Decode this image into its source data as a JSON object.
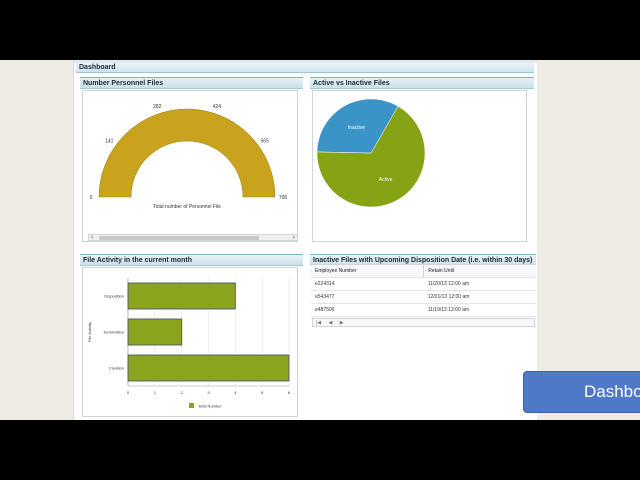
{
  "dashboard": {
    "title": "Dashboard"
  },
  "gauge_panel": {
    "title": "Number Personnel Files",
    "caption": "Total number of Personnel File",
    "chart_data": {
      "type": "gauge",
      "min": 0,
      "max": 706,
      "value": 600,
      "ticks": [
        0,
        141,
        282,
        424,
        565,
        706
      ],
      "color": "#c9a21e",
      "xlabel": "Total number of Personnel File"
    }
  },
  "pie_panel": {
    "title": "Active vs Inactive Files",
    "chart_data": {
      "type": "pie",
      "slices": [
        {
          "label": "Active",
          "value": 67,
          "color": "#86a315"
        },
        {
          "label": "Inactive",
          "value": 33,
          "color": "#3a95c6"
        }
      ]
    }
  },
  "bar_panel": {
    "title": "File Activity in the current month",
    "chart_data": {
      "type": "bar",
      "orientation": "horizontal",
      "categories": [
        "Disposition",
        "Termination",
        "Creation"
      ],
      "series": [
        {
          "name": "Total Number",
          "values": [
            4,
            2,
            6
          ],
          "color": "#8aa51d"
        }
      ],
      "ylabel": "File Activity",
      "xlim": [
        0,
        6
      ],
      "x_ticks": [
        "0",
        "1",
        "2",
        "3",
        "4",
        "5",
        "6"
      ],
      "grid": true,
      "legend": "bottom"
    }
  },
  "table_panel": {
    "title": "Inactive Files with Upcoming Disposition Date (i.e. within 30 days)",
    "columns": [
      "Employee Number",
      "Retain Until"
    ],
    "rows": [
      [
        "e224314",
        "11/20/13 12:00 am"
      ],
      [
        "e543477",
        "12/01/13 12:00 am"
      ],
      [
        "e487500",
        "11/19/13 12:00 am"
      ]
    ],
    "pager": [
      "|◀",
      "◀",
      "▶"
    ]
  },
  "side_button": {
    "label": "Dashboard"
  }
}
